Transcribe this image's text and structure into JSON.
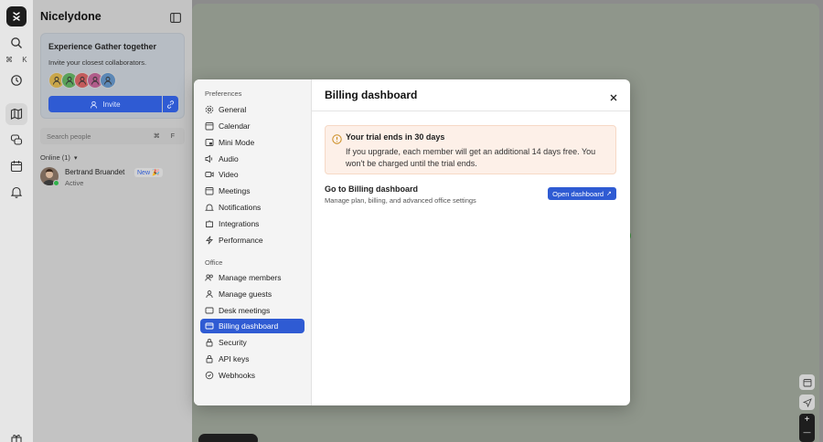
{
  "workspace": {
    "name": "Nicelydone"
  },
  "rail": {
    "search_shortcut": "⌘ K"
  },
  "promo": {
    "title": "Experience Gather together",
    "subtitle": "Invite your closest collaborators.",
    "invite_label": "Invite",
    "avatar_colors": [
      "#c9a64a",
      "#5aa15a",
      "#c35c5c",
      "#b05c8a",
      "#5b87b5"
    ]
  },
  "search": {
    "placeholder": "Search people",
    "shortcut": "⌘ F"
  },
  "online": {
    "label": "Online (1)"
  },
  "users": [
    {
      "name": "Bertrand Bruandet",
      "badge": "New 🎉",
      "status": "Active"
    }
  ],
  "modal": {
    "sections": [
      {
        "label": "Preferences",
        "items": [
          "General",
          "Calendar",
          "Mini Mode",
          "Audio",
          "Video",
          "Meetings",
          "Notifications",
          "Integrations",
          "Performance"
        ]
      },
      {
        "label": "Office",
        "items": [
          "Manage members",
          "Manage guests",
          "Desk meetings",
          "Billing dashboard",
          "Security",
          "API keys",
          "Webhooks"
        ]
      }
    ],
    "selected": "Billing dashboard",
    "title": "Billing dashboard",
    "alert": {
      "title": "Your trial ends in 30 days",
      "body": "If you upgrade, each member will get an additional 14 days free. You won't be charged until the trial ends."
    },
    "goto": {
      "title": "Go to Billing dashboard",
      "subtitle": "Manage plan, billing, and advanced office settings",
      "button_label": "Open dashboard"
    }
  },
  "map_controls": {
    "zoom_in": "+",
    "zoom_out": "—"
  },
  "colors": {
    "accent": "#2f5bd3",
    "online": "#2fb24a",
    "alert_bg": "#fdf0e8"
  }
}
